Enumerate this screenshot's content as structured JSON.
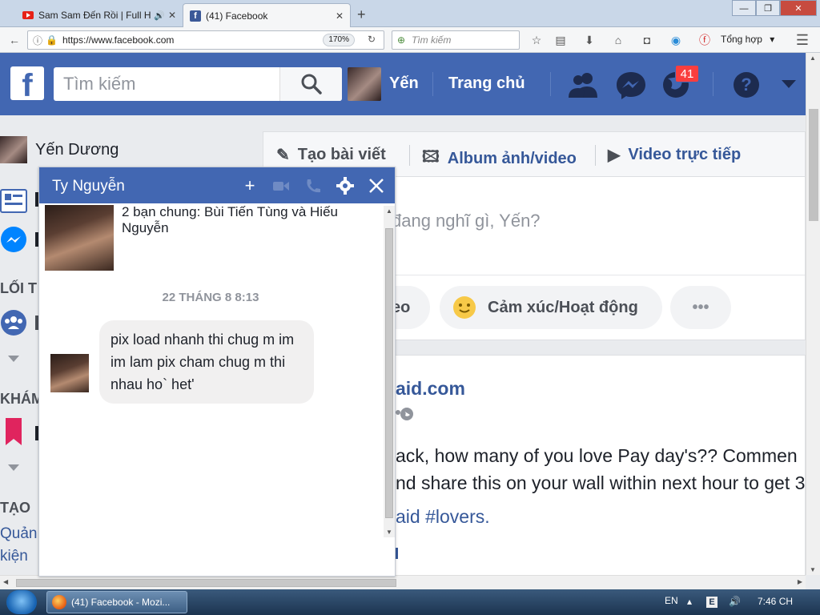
{
  "browser": {
    "tabs": [
      {
        "label": "Sam Sam Đến Rồi | Full H",
        "active": false
      },
      {
        "label": "(41) Facebook",
        "active": true
      }
    ],
    "url": "https://www.facebook.com",
    "zoom": "170%",
    "search_placeholder": "Tìm kiếm",
    "toolbar_extra_label": "Tổng hợp"
  },
  "fb": {
    "logo_letter": "f",
    "search_placeholder": "Tìm kiếm",
    "user_short": "Yến",
    "home_label": "Trang chủ",
    "notification_count": "41"
  },
  "left": {
    "user_full": "Yến Dương",
    "section1_partial": "LỐI T",
    "section2_partial": "KHÁM",
    "section3_partial": "TẠO",
    "create_link1_partial": "Quản",
    "create_link2_partial": "kiện"
  },
  "composer": {
    "tab_post": "Tạo bài viết",
    "tab_album": "Album ảnh/video",
    "tab_live": "Video trực tiếp",
    "placeholder_partial": "đang nghĩ gì, Yến?",
    "pill_video_partial": "eo",
    "pill_feeling": "Cảm xúc/Hoạt động",
    "pill_more": "•••"
  },
  "post": {
    "source_partial": "aid.com",
    "line1": "ack, how many of you love Pay day's?? Commen",
    "line2": "nd share this on your wall within next hour to get 3",
    "line3_partial": "aid #lovers."
  },
  "chat": {
    "title": "Ty Nguyễn",
    "mutual_friends": "2 bạn chung: Bùi Tiến Tùng và Hiếu Nguyễn",
    "timestamp": "22 THÁNG 8 8:13",
    "message": "pix load nhanh thi chug m im im lam pix cham chug m thi nhau ho` het'"
  },
  "taskbar": {
    "window_label": "(41) Facebook - Mozi...",
    "language": "EN",
    "clock": "7:46 CH"
  },
  "colors": {
    "fb_blue": "#4267b2",
    "link_blue": "#365899",
    "badge_red": "#fa3e3e"
  }
}
